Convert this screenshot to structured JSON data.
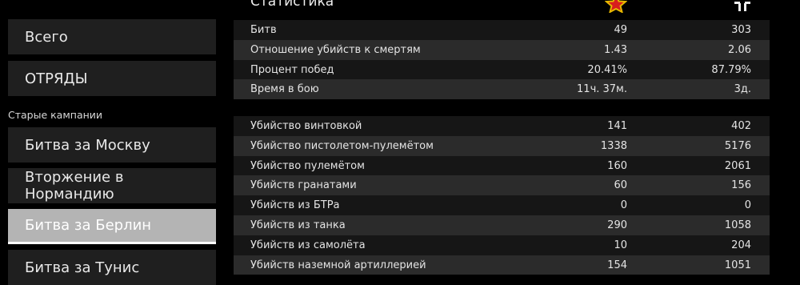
{
  "colors": {
    "row_dark": "#161616",
    "row_light": "#2b2b2b",
    "nav_bg": "#1f1f1f",
    "nav_active": "#b4b4b4"
  },
  "sidebar": {
    "items_top": [
      {
        "label": "Всего"
      },
      {
        "label": "ОТРЯДЫ"
      }
    ],
    "section_label": "Старые кампании",
    "items_campaigns": [
      {
        "label": "Битва за Москву",
        "active": false
      },
      {
        "label": "Вторжение в Нормандию",
        "active": false
      },
      {
        "label": "Битва за Берлин",
        "active": true
      },
      {
        "label": "Битва за Тунис",
        "active": false
      }
    ]
  },
  "main": {
    "title": "Статистика",
    "column_icons": [
      "soviet-star-icon",
      "german-cross-icon"
    ],
    "group1": [
      {
        "label": "Битв",
        "v1": "49",
        "v2": "303"
      },
      {
        "label": "Отношение убийств к смертям",
        "v1": "1.43",
        "v2": "2.06"
      },
      {
        "label": "Процент побед",
        "v1": "20.41%",
        "v2": "87.79%"
      },
      {
        "label": "Время в бою",
        "v1": "11ч. 37м.",
        "v2": "3д."
      }
    ],
    "group2": [
      {
        "label": "Убийство винтовкой",
        "v1": "141",
        "v2": "402"
      },
      {
        "label": "Убийство пистолетом-пулемётом",
        "v1": "1338",
        "v2": "5176"
      },
      {
        "label": "Убийство пулемётом",
        "v1": "160",
        "v2": "2061"
      },
      {
        "label": "Убийств гранатами",
        "v1": "60",
        "v2": "156"
      },
      {
        "label": "Убийств из БТРа",
        "v1": "0",
        "v2": "0"
      },
      {
        "label": "Убийств из танка",
        "v1": "290",
        "v2": "1058"
      },
      {
        "label": "Убийств из самолёта",
        "v1": "10",
        "v2": "204"
      },
      {
        "label": "Убийств наземной артиллерией",
        "v1": "154",
        "v2": "1051"
      }
    ]
  }
}
